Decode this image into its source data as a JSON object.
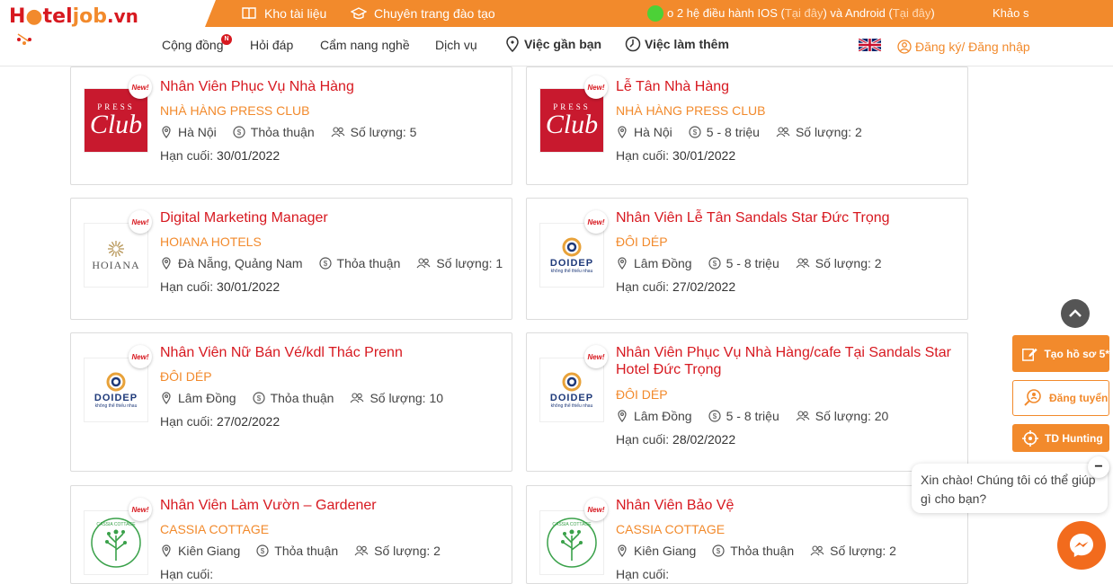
{
  "header": {
    "logo": {
      "part1": "H",
      "part2": "tel",
      "part3": "j",
      "part4": "ob",
      "part5": ".vn"
    },
    "strip": {
      "docs_label": "Kho tài liệu",
      "training_label": "Chuyên trang đào tạo",
      "marquee_text_1": "o 2 hệ điều hành IOS (",
      "marquee_link_1": "Tại đây",
      "marquee_text_2": ") và Android (",
      "marquee_link_2": "Tại đây",
      "marquee_text_3": ")",
      "survey_label": "Khảo s"
    },
    "nav": {
      "community": "Cộng đồng",
      "community_badge": "N",
      "qa": "Hỏi đáp",
      "handbook": "Cẩm nang nghề",
      "services": "Dịch vụ",
      "jobs_nearby": "Việc gần bạn",
      "part_time": "Việc làm thêm",
      "login": "Đăng ký/ Đăng nhập"
    }
  },
  "jobs": [
    {
      "title": "Nhân Viên Phục Vụ Nhà Hàng",
      "company": "NHÀ HÀNG PRESS CLUB",
      "location": "Hà Nội",
      "salary": "Thỏa thuận",
      "quantity": "Số lượng: 5",
      "deadline_label": "Hạn cuối:",
      "deadline": "30/01/2022",
      "badge": "New!",
      "logo": "pressclub"
    },
    {
      "title": "Lễ Tân Nhà Hàng",
      "company": "NHÀ HÀNG PRESS CLUB",
      "location": "Hà Nội",
      "salary": "5 - 8 triệu",
      "quantity": "Số lượng: 2",
      "deadline_label": "Hạn cuối:",
      "deadline": "30/01/2022",
      "badge": "New!",
      "logo": "pressclub"
    },
    {
      "title": "Digital Marketing Manager",
      "company": "HOIANA HOTELS",
      "location": "Đà Nẵng, Quảng Nam",
      "salary": "Thỏa thuận",
      "quantity": "Số lượng: 1",
      "deadline_label": "Hạn cuối:",
      "deadline": "30/01/2022",
      "badge": "New!",
      "logo": "hoiana"
    },
    {
      "title": "Nhân Viên Lễ Tân Sandals Star Đức Trọng",
      "company": "ĐÔI DÉP",
      "location": "Lâm Đồng",
      "salary": "5 - 8 triệu",
      "quantity": "Số lượng: 2",
      "deadline_label": "Hạn cuối:",
      "deadline": "27/02/2022",
      "badge": "New!",
      "logo": "doidep"
    },
    {
      "title": "Nhân Viên Nữ Bán Vé/kdl Thác Prenn",
      "company": "ĐÔI DÉP",
      "location": "Lâm Đồng",
      "salary": "Thỏa thuận",
      "quantity": "Số lượng: 10",
      "deadline_label": "Hạn cuối:",
      "deadline": "27/02/2022",
      "badge": "New!",
      "logo": "doidep"
    },
    {
      "title": "Nhân Viên Phục Vụ Nhà Hàng/cafe Tại Sandals Star Hotel Đức Trọng",
      "company": "ĐÔI DÉP",
      "location": "Lâm Đồng",
      "salary": "5 - 8 triệu",
      "quantity": "Số lượng: 20",
      "deadline_label": "Hạn cuối:",
      "deadline": "28/02/2022",
      "badge": "New!",
      "logo": "doidep"
    },
    {
      "title": "Nhân Viên Làm Vườn – Gardener",
      "company": "CASSIA COTTAGE",
      "location": "Kiên Giang",
      "salary": "Thỏa thuận",
      "quantity": "Số lượng: 2",
      "deadline_label": "Hạn cuối:",
      "deadline": "",
      "badge": "New!",
      "logo": "cassia"
    },
    {
      "title": "Nhân Viên Bảo Vệ",
      "company": "CASSIA COTTAGE",
      "location": "Kiên Giang",
      "salary": "Thỏa thuận",
      "quantity": "Số lượng: 2",
      "deadline_label": "Hạn cuối:",
      "deadline": "",
      "badge": "New!",
      "logo": "cassia"
    }
  ],
  "logos": {
    "pressclub": {
      "top": "PRESS",
      "main": "Club"
    },
    "hoiana": {
      "name": "HOIANA"
    },
    "doidep": {
      "name": "DOIDEP",
      "tagline": "không thể thiếu nhau"
    },
    "cassia": {
      "name": "CASSIA COTTAGE"
    }
  },
  "side": {
    "create_cv": "Tạo hồ sơ 5*",
    "post_job": "Đăng tuyển",
    "hunting": "TD Hunting"
  },
  "chat": {
    "greeting": "Xin chào! Chúng tôi có thể giúp gì cho bạn?",
    "close": "−"
  },
  "colors": {
    "brand_orange": "#f28a2c",
    "brand_red": "#d71920",
    "online_green": "#4cd137"
  }
}
